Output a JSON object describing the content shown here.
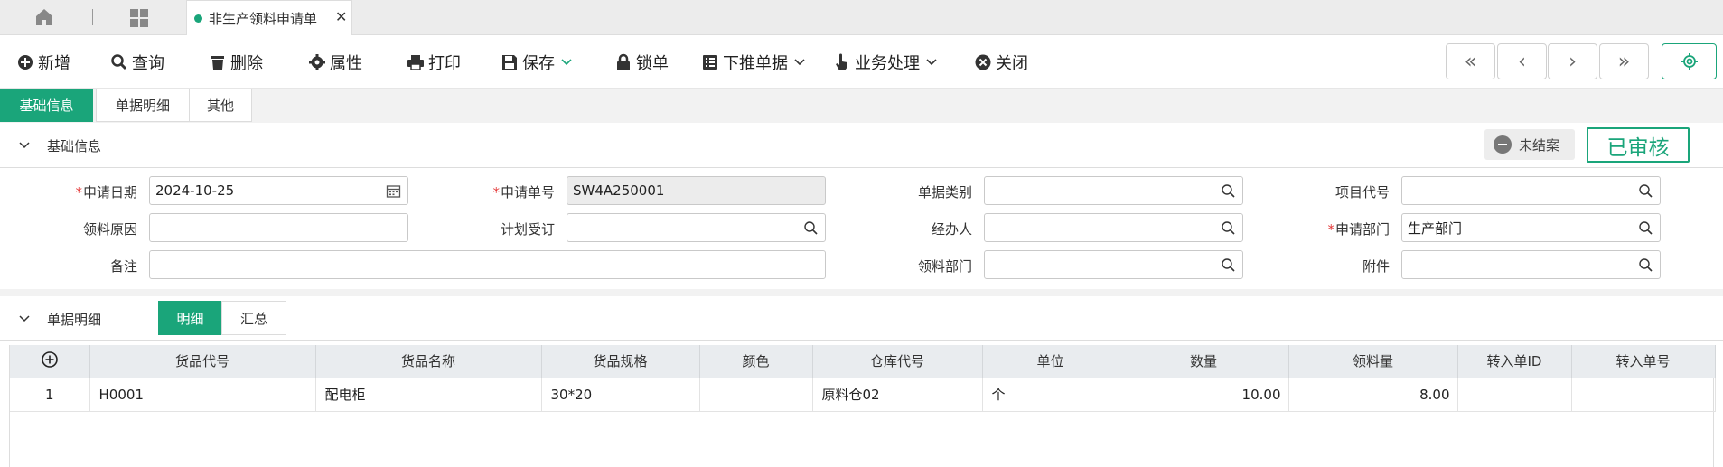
{
  "tabs": {
    "document_tab_label": "非生产领料申请单",
    "close_glyph": "✕"
  },
  "toolbar": {
    "add": "新增",
    "query": "查询",
    "delete": "删除",
    "properties": "属性",
    "print": "打印",
    "save": "保存",
    "lock": "锁单",
    "push_down": "下推单据",
    "business": "业务处理",
    "close": "关闭"
  },
  "record_nav": {
    "first": "«",
    "prev": "‹",
    "next": "›",
    "last": "»"
  },
  "subtabs": [
    "基础信息",
    "单据明细",
    "其他"
  ],
  "basic_section": {
    "title": "基础信息",
    "status_unfinished": "未结案",
    "status_audited": "已审核"
  },
  "form": {
    "apply_date_label": "申请日期",
    "apply_date_value": "2024-10-25",
    "apply_no_label": "申请单号",
    "apply_no_value": "SW4A250001",
    "doc_type_label": "单据类别",
    "doc_type_value": "",
    "project_code_label": "项目代号",
    "project_code_value": "",
    "reason_label": "领料原因",
    "reason_value": "",
    "plan_order_label": "计划受订",
    "plan_order_value": "",
    "handler_label": "经办人",
    "handler_value": "",
    "apply_dept_label": "申请部门",
    "apply_dept_value": "生产部门",
    "remark_label": "备注",
    "remark_value": "",
    "pick_dept_label": "领料部门",
    "pick_dept_value": "",
    "attachment_label": "附件",
    "attachment_value": ""
  },
  "detail_section": {
    "title": "单据明细",
    "seg_detail": "明细",
    "seg_summary": "汇总"
  },
  "grid": {
    "add_glyph": "⊕",
    "columns": [
      "货品代号",
      "货品名称",
      "货品规格",
      "颜色",
      "仓库代号",
      "单位",
      "数量",
      "领料量",
      "转入单ID",
      "转入单号"
    ],
    "rows": [
      {
        "index": "1",
        "code": "H0001",
        "name": "配电柜",
        "spec": "30*20",
        "color": "",
        "warehouse": "原料仓02",
        "unit": "个",
        "qty": "10.00",
        "pick_qty": "8.00",
        "in_id": "",
        "in_no": ""
      }
    ]
  },
  "colors": {
    "accent": "#1aa57a",
    "required": "#e43c3c",
    "header_bg": "#e9ecef"
  }
}
